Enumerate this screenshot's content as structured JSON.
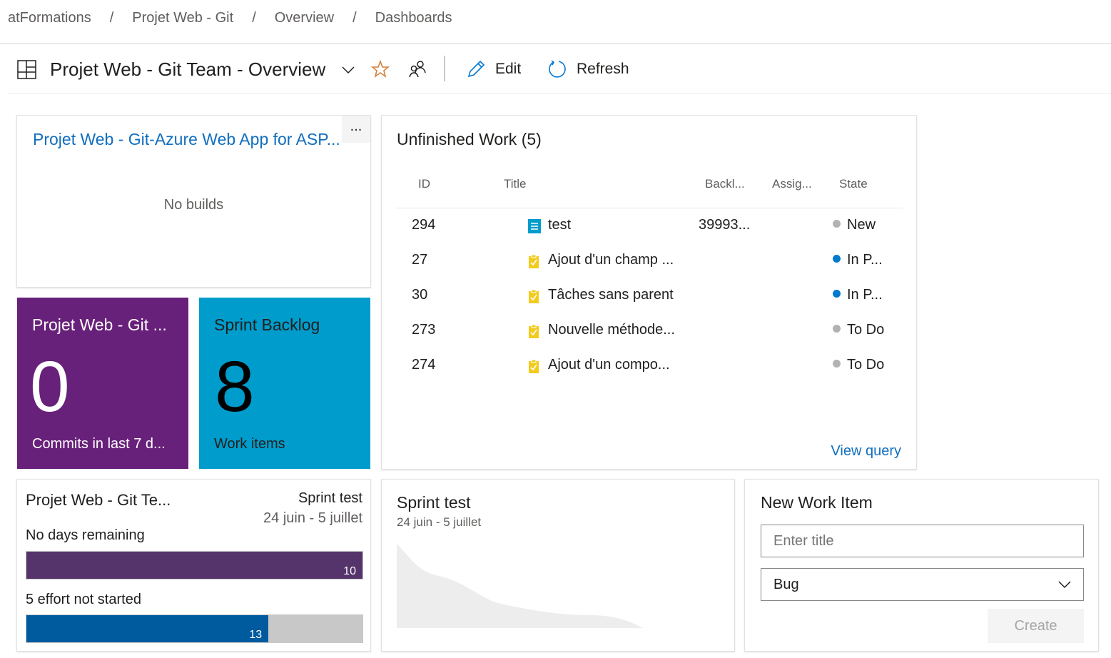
{
  "breadcrumb": [
    "atFormations",
    "Projet Web - Git",
    "Overview",
    "Dashboards"
  ],
  "header": {
    "title": "Projet Web - Git Team - Overview",
    "edit_label": "Edit",
    "refresh_label": "Refresh",
    "icons": [
      "dashboard-icon",
      "chevron-down-icon",
      "favorite-star-icon",
      "team-members-icon",
      "pencil-icon",
      "refresh-icon"
    ]
  },
  "colors": {
    "accent": "#0078d4",
    "purple_tile": "#68217a",
    "teal_tile": "#009ccc",
    "burndown_purple": "#54346a",
    "effort_blue": "#005a9e"
  },
  "build_widget": {
    "title": "Projet Web - Git-Azure Web App for ASP...",
    "more": "...",
    "empty": "No builds"
  },
  "commits_tile": {
    "title": "Projet Web - Git ...",
    "value": "0",
    "caption": "Commits in last 7 d..."
  },
  "backlog_tile": {
    "title": "Sprint Backlog",
    "value": "8",
    "caption": "Work items"
  },
  "unfinished": {
    "title": "Unfinished Work (5)",
    "columns": [
      "ID",
      "Title",
      "Backl...",
      "Assig...",
      "State"
    ],
    "rows": [
      {
        "id": "294",
        "type": "backlog-item",
        "title": "test",
        "backlog": "39993...",
        "assigned": "",
        "state": "New",
        "state_color": "#b2b2b2"
      },
      {
        "id": "27",
        "type": "task",
        "title": "Ajout d'un champ ...",
        "backlog": "",
        "assigned": "",
        "state": "In P...",
        "state_color": "#007acc"
      },
      {
        "id": "30",
        "type": "task",
        "title": "Tâches sans parent",
        "backlog": "",
        "assigned": "",
        "state": "In P...",
        "state_color": "#007acc"
      },
      {
        "id": "273",
        "type": "task",
        "title": "Nouvelle méthode...",
        "backlog": "",
        "assigned": "",
        "state": "To Do",
        "state_color": "#b2b2b2"
      },
      {
        "id": "274",
        "type": "task",
        "title": "Ajout d'un compo...",
        "backlog": "",
        "assigned": "",
        "state": "To Do",
        "state_color": "#b2b2b2"
      }
    ],
    "view_query": "View query"
  },
  "sprint_overview": {
    "team": "Projet Web - Git Te...",
    "sprint": "Sprint test",
    "dates": "24 juin - 5 juillet",
    "days_label": "No days remaining",
    "days_value": "10",
    "effort_label": "5 effort not started",
    "effort_value": "13",
    "effort_fraction": 0.72
  },
  "burndown": {
    "title": "Sprint test",
    "dates": "24 juin - 5 juillet"
  },
  "new_work_item": {
    "title": "New Work Item",
    "placeholder": "Enter title",
    "type": "Bug",
    "create": "Create"
  }
}
